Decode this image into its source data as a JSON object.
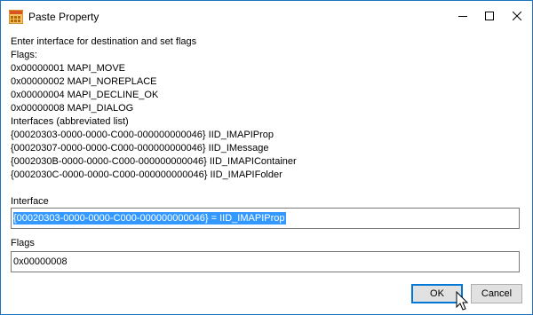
{
  "window": {
    "title": "Paste Property"
  },
  "instructions": {
    "lines": [
      "Enter interface for destination and set flags",
      "Flags:",
      "0x00000001 MAPI_MOVE",
      "0x00000002 MAPI_NOREPLACE",
      "0x00000004 MAPI_DECLINE_OK",
      "0x00000008 MAPI_DIALOG",
      "Interfaces (abbreviated list)",
      "{00020303-0000-0000-C000-000000000046} IID_IMAPIProp",
      "{00020307-0000-0000-C000-000000000046} IID_IMessage",
      "{0002030B-0000-0000-C000-000000000046} IID_IMAPIContainer",
      "{0002030C-0000-0000-C000-000000000046} IID_IMAPIFolder"
    ]
  },
  "interface": {
    "label": "Interface",
    "value": "{00020303-0000-0000-C000-000000000046} = IID_IMAPIProp"
  },
  "flags": {
    "label": "Flags",
    "value": "0x00000008"
  },
  "buttons": {
    "ok": "OK",
    "cancel": "Cancel"
  },
  "icons": {
    "app": "mapi-app-icon",
    "minimize": "minimize-icon",
    "maximize": "maximize-icon",
    "close": "close-icon",
    "cursor": "mouse-pointer-icon"
  },
  "colors": {
    "border": "#1e73be",
    "selection": "#3399ff",
    "button_face": "#e1e1e1",
    "default_button_border": "#0078d7"
  }
}
